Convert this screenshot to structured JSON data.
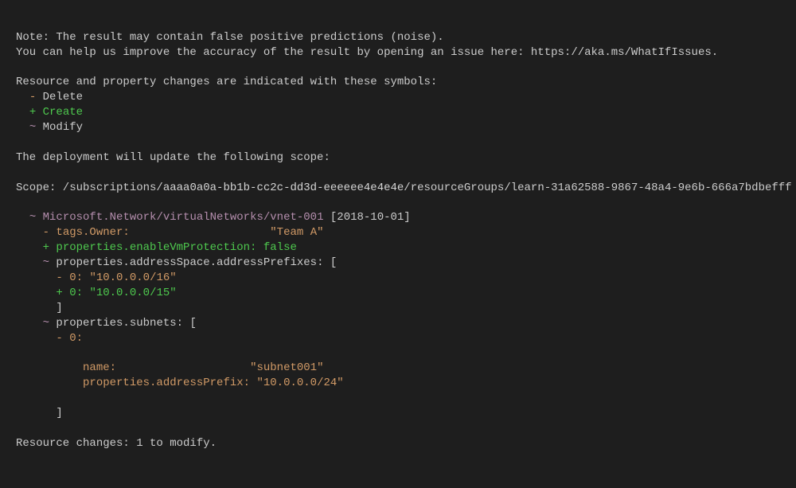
{
  "note_line1": "Note: The result may contain false positive predictions (noise).",
  "note_line2": "You can help us improve the accuracy of the result by opening an issue here: https://aka.ms/WhatIfIssues.",
  "symbols_header": "Resource and property changes are indicated with these symbols:",
  "delete_sym": "-",
  "delete_label": "Delete",
  "create_sym": "+",
  "create_label": "Create",
  "modify_sym": "~",
  "modify_label": "Modify",
  "scope_header": "The deployment will update the following scope:",
  "scope_prefix": "Scope: /subscriptions/",
  "subscription_id": "aaaa0a0a-bb1b-cc2c-dd3d-eeeeee4e4e4e",
  "scope_suffix": "/resourceGroups/learn-31a62588-9867-48a4-9e6b-666a7bdbefff",
  "resource_tilde": "~",
  "resource_path": "Microsoft.Network/virtualNetworks/vnet-001",
  "api_version": "[2018-10-01]",
  "tags_minus": "-",
  "tags_key": "tags.Owner:",
  "tags_value": "\"Team A\"",
  "enablevm_plus": "+",
  "enablevm_key": "properties.enableVmProtection:",
  "enablevm_value": "false",
  "addrspace_tilde": "~",
  "addrspace_key": "properties.addressSpace.addressPrefixes:",
  "addrspace_bracket": "[",
  "addr_minus": "-",
  "addr_minus_idx": "0:",
  "addr_minus_val": "\"10.0.0.0/16\"",
  "addr_plus": "+",
  "addr_plus_idx": "0:",
  "addr_plus_val": "\"10.0.0.0/15\"",
  "close_bracket1": "]",
  "subnets_tilde": "~",
  "subnets_key": "properties.subnets:",
  "subnets_bracket": "[",
  "subnet_minus": "-",
  "subnet_idx": "0:",
  "subnet_name_key": "name:",
  "subnet_name_val": "\"subnet001\"",
  "subnet_prefix_key": "properties.addressPrefix:",
  "subnet_prefix_val": "\"10.0.0.0/24\"",
  "close_bracket2": "]",
  "summary": "Resource changes: 1 to modify."
}
